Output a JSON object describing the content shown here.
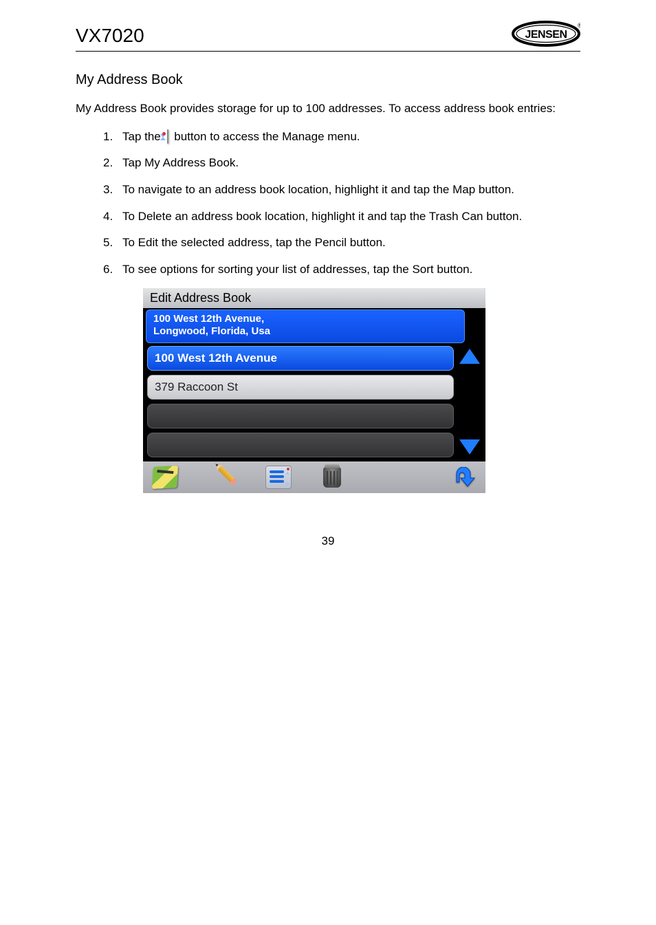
{
  "header": {
    "product": "VX7020",
    "brand": "JENSEN"
  },
  "section_title": "My Address Book",
  "intro": "My Address Book provides storage for up to 100 addresses. To access address book entries:",
  "steps": [
    {
      "num": "1.",
      "text_before": "Tap the ",
      "text_after": " button to access the Manage menu."
    },
    {
      "num": "2.",
      "text": "Tap My Address Book."
    },
    {
      "num": "3.",
      "text": "To navigate to an address book location, highlight it and tap the Map button."
    },
    {
      "num": "4.",
      "text": "To Delete an address book location, highlight it and tap the Trash Can button."
    },
    {
      "num": "5.",
      "text": "To Edit the selected address, tap the Pencil button."
    },
    {
      "num": "6.",
      "text": "To see options for sorting your list of addresses, tap the Sort button."
    }
  ],
  "screenshot": {
    "title": "Edit Address Book",
    "full_address_line1": "100 West 12th Avenue,",
    "full_address_line2": "Longwood, Florida, Usa",
    "rows": {
      "row1": "100 West 12th Avenue",
      "row2": "379 Raccoon St"
    },
    "toolbar": {
      "map": "map-icon",
      "edit": "pencil-icon",
      "sort": "list-icon",
      "delete": "trash-icon",
      "back": "back-icon"
    }
  },
  "page_number": "39"
}
